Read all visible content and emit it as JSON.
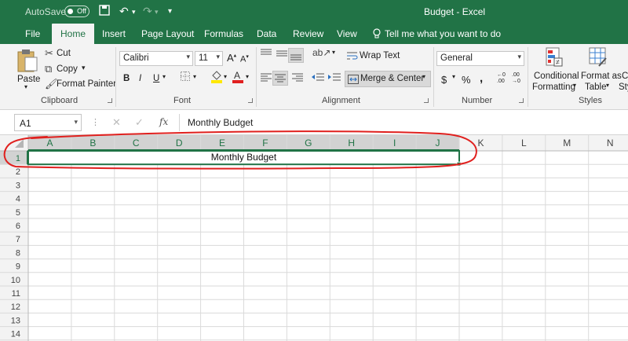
{
  "title": {
    "autosave_label": "AutoSave",
    "autosave_state": "Off",
    "document": "Budget  -  Excel"
  },
  "tabs": [
    {
      "label": "File",
      "active": false
    },
    {
      "label": "Home",
      "active": true
    },
    {
      "label": "Insert",
      "active": false
    },
    {
      "label": "Page Layout",
      "active": false
    },
    {
      "label": "Formulas",
      "active": false
    },
    {
      "label": "Data",
      "active": false
    },
    {
      "label": "Review",
      "active": false
    },
    {
      "label": "View",
      "active": false
    }
  ],
  "tell_me": "Tell me what you want to do",
  "ribbon": {
    "clipboard": {
      "paste": "Paste",
      "cut": "Cut",
      "copy": "Copy",
      "format_painter": "Format Painter",
      "label": "Clipboard"
    },
    "font": {
      "name": "Calibri",
      "size": "11",
      "bold": "B",
      "italic": "I",
      "underline": "U",
      "label": "Font"
    },
    "alignment": {
      "wrap_text": "Wrap Text",
      "merge_center": "Merge & Center",
      "label": "Alignment"
    },
    "number": {
      "format": "General",
      "currency": "$",
      "percent": "%",
      "comma": ",",
      "label": "Number"
    },
    "styles": {
      "conditional": [
        "Conditional",
        "Formatting"
      ],
      "format_as": [
        "Format as",
        "Table"
      ],
      "cell_styles": [
        "C",
        "Sty"
      ],
      "label": "Styles"
    }
  },
  "formula_bar": {
    "name_box": "A1",
    "fx": "fx",
    "content": "Monthly Budget"
  },
  "sheet": {
    "columns": [
      "A",
      "B",
      "C",
      "D",
      "E",
      "F",
      "G",
      "H",
      "I",
      "J",
      "K",
      "L",
      "M",
      "N"
    ],
    "rows": [
      "1",
      "2",
      "3",
      "4",
      "5",
      "6",
      "7",
      "8",
      "9",
      "10",
      "11",
      "12",
      "13",
      "14"
    ],
    "merged_cell": {
      "range": "A1:J1",
      "value": "Monthly Budget"
    }
  },
  "annotation_color": "#e0201e",
  "accent": "#217346"
}
